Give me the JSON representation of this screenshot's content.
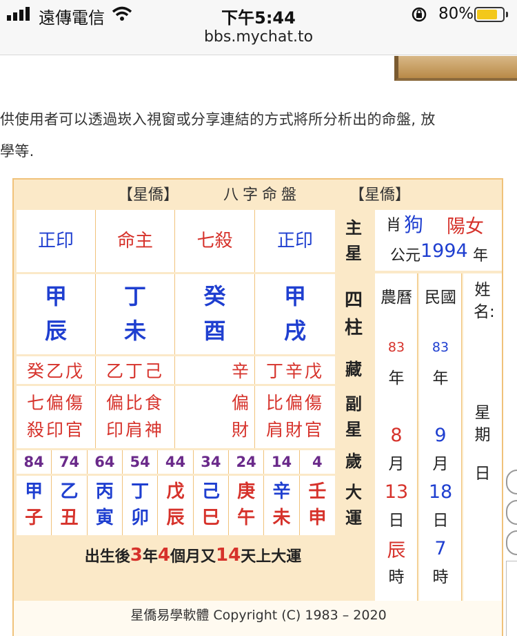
{
  "status": {
    "carrier": "遠傳電信",
    "time": "下午5:44",
    "battery": "80%",
    "url": "bbs.mychat.to"
  },
  "intro": [
    "供使用者可以透過崁入視窗或分享連結的方式將所分析出的命盤, 放",
    "學等."
  ],
  "chart": {
    "header_left": "【星僑】",
    "header_title": "八字命盤",
    "header_right": "【星僑】",
    "main_star": [
      "正印",
      "命主",
      "七殺",
      "正印"
    ],
    "label_main_star": "主星",
    "pillar_top": [
      "甲",
      "丁",
      "癸",
      "甲"
    ],
    "pillar_bottom": [
      "辰",
      "未",
      "酉",
      "戌"
    ],
    "label_pillars": "四柱",
    "hidden": [
      "癸乙戊",
      "乙丁己",
      "辛",
      "丁辛戊"
    ],
    "label_hidden": "藏",
    "sub_top": [
      "七偏傷",
      "偏比食",
      "偏",
      "比偏傷"
    ],
    "sub_bottom": [
      "殺印官",
      "印肩神",
      "財",
      "肩財官"
    ],
    "label_sub": "副星",
    "ages": [
      "84",
      "74",
      "64",
      "54",
      "44",
      "34",
      "24",
      "14",
      "4"
    ],
    "label_age": "歲",
    "luck_top": [
      "甲",
      "乙",
      "丙",
      "丁",
      "戊",
      "己",
      "庚",
      "辛",
      "壬"
    ],
    "luck_bottom": [
      "子",
      "丑",
      "寅",
      "卯",
      "辰",
      "巳",
      "午",
      "未",
      "申"
    ],
    "label_luck": "大運",
    "luck_start": {
      "a": "出生後",
      "b": "3",
      "c": "年",
      "d": "4",
      "e": "個月又",
      "f": "14",
      "g": "天上大運"
    },
    "info": {
      "zodiac_label": "肖",
      "zodiac": "狗",
      "gender": "陽女",
      "year_label": "公元",
      "year": "1994",
      "year_unit": "年",
      "lunar_label": "農曆",
      "lunar_year": "83",
      "lunar_month": "8",
      "lunar_day": "13",
      "lunar_hour": "辰",
      "roc_label": "民國",
      "roc_year": "83",
      "roc_month": "9",
      "roc_day": "18",
      "roc_hour": "7",
      "unit_year": "年",
      "unit_month": "月",
      "unit_day": "日",
      "unit_hour": "時",
      "name_label": "姓名:",
      "weekday_label": "星期",
      "weekday": "日"
    }
  },
  "footer": "星僑易學軟體 Copyright (C) 1983 – 2020"
}
